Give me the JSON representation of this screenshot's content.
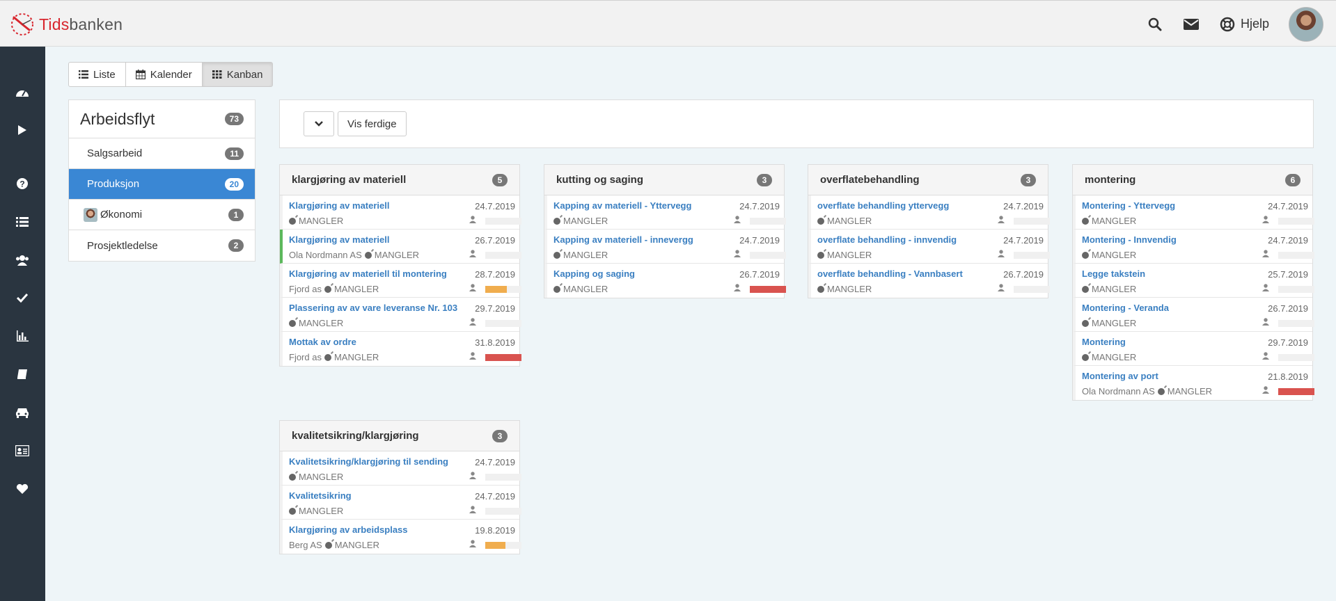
{
  "brand": {
    "part1": "Tids",
    "part2": "banken"
  },
  "header": {
    "help_label": "Hjelp"
  },
  "views": [
    {
      "label": "Liste",
      "icon": "list-icon"
    },
    {
      "label": "Kalender",
      "icon": "calendar-icon"
    },
    {
      "label": "Kanban",
      "icon": "grid-icon",
      "active": true
    }
  ],
  "workflow": {
    "title": "Arbeidsflyt",
    "count": "73",
    "items": [
      {
        "label": "Salgsarbeid",
        "count": "11"
      },
      {
        "label": "Produksjon",
        "count": "20",
        "active": true
      },
      {
        "label": "Økonomi",
        "count": "1",
        "avatar": true
      },
      {
        "label": "Prosjektledelse",
        "count": "2"
      }
    ]
  },
  "filter": {
    "show_done_label": "Vis ferdige"
  },
  "colors": {
    "accent": "#3a87d4",
    "warn": "#f0ad4e",
    "danger": "#d9534f",
    "ok": "#5cb85c"
  },
  "columns": [
    {
      "title": "klargjøring av materiell",
      "count": "5",
      "cards": [
        {
          "title": "Klargjøring av materiell",
          "date": "24.7.2019",
          "customer": "",
          "tag": "MANGLER",
          "progress": 0,
          "status": ""
        },
        {
          "title": "Klargjøring av materiell",
          "date": "26.7.2019",
          "customer": "Ola Nordmann AS",
          "tag": "MANGLER",
          "progress": 0,
          "status": "",
          "marker": "green"
        },
        {
          "title": "Klargjøring av materiell til montering",
          "date": "28.7.2019",
          "customer": "Fjord as",
          "tag": "MANGLER",
          "progress": 0.6,
          "status": "warn"
        },
        {
          "title": "Plassering av av vare leveranse Nr. 103",
          "date": "29.7.2019",
          "customer": "",
          "tag": "MANGLER",
          "progress": 0,
          "status": ""
        },
        {
          "title": "Mottak av ordre",
          "date": "31.8.2019",
          "customer": "Fjord as",
          "tag": "MANGLER",
          "progress": 1,
          "status": "danger"
        }
      ]
    },
    {
      "title": "kutting og saging",
      "count": "3",
      "cards": [
        {
          "title": "Kapping av materiell - Yttervegg",
          "date": "24.7.2019",
          "customer": "",
          "tag": "MANGLER",
          "progress": 0,
          "status": ""
        },
        {
          "title": "Kapping av materiell - innevergg",
          "date": "24.7.2019",
          "customer": "",
          "tag": "MANGLER",
          "progress": 0,
          "status": ""
        },
        {
          "title": "Kapping og saging",
          "date": "26.7.2019",
          "customer": "",
          "tag": "MANGLER",
          "progress": 1,
          "status": "danger"
        }
      ]
    },
    {
      "title": "overflatebehandling",
      "count": "3",
      "cards": [
        {
          "title": "overflate behandling yttervegg",
          "date": "24.7.2019",
          "customer": "",
          "tag": "MANGLER",
          "progress": 0,
          "status": ""
        },
        {
          "title": "overflate behandling - innvendig",
          "date": "24.7.2019",
          "customer": "",
          "tag": "MANGLER",
          "progress": 0,
          "status": ""
        },
        {
          "title": "overflate behandling - Vannbasert",
          "date": "26.7.2019",
          "customer": "",
          "tag": "MANGLER",
          "progress": 0,
          "status": ""
        }
      ]
    },
    {
      "title": "montering",
      "count": "6",
      "cards": [
        {
          "title": "Montering - Yttervegg",
          "date": "24.7.2019",
          "customer": "",
          "tag": "MANGLER",
          "progress": 0,
          "status": ""
        },
        {
          "title": "Montering - Innvendig",
          "date": "24.7.2019",
          "customer": "",
          "tag": "MANGLER",
          "progress": 0,
          "status": ""
        },
        {
          "title": "Legge takstein",
          "date": "25.7.2019",
          "customer": "",
          "tag": "MANGLER",
          "progress": 0,
          "status": ""
        },
        {
          "title": "Montering - Veranda",
          "date": "26.7.2019",
          "customer": "",
          "tag": "MANGLER",
          "progress": 0,
          "status": ""
        },
        {
          "title": "Montering",
          "date": "29.7.2019",
          "customer": "",
          "tag": "MANGLER",
          "progress": 0,
          "status": ""
        },
        {
          "title": "Montering av port",
          "date": "21.8.2019",
          "customer": "Ola Nordmann AS",
          "tag": "MANGLER",
          "progress": 1,
          "status": "danger"
        }
      ]
    },
    {
      "title": "kvalitetsikring/klargjøring",
      "count": "3",
      "cards": [
        {
          "title": "Kvalitetsikring/klargjøring til sending",
          "date": "24.7.2019",
          "customer": "",
          "tag": "MANGLER",
          "progress": 0,
          "status": ""
        },
        {
          "title": "Kvalitetsikring",
          "date": "24.7.2019",
          "customer": "",
          "tag": "MANGLER",
          "progress": 0,
          "status": ""
        },
        {
          "title": "Klargjøring av arbeidsplass",
          "date": "19.8.2019",
          "customer": "Berg AS",
          "tag": "MANGLER",
          "progress": 0.55,
          "status": "warn"
        }
      ]
    }
  ]
}
